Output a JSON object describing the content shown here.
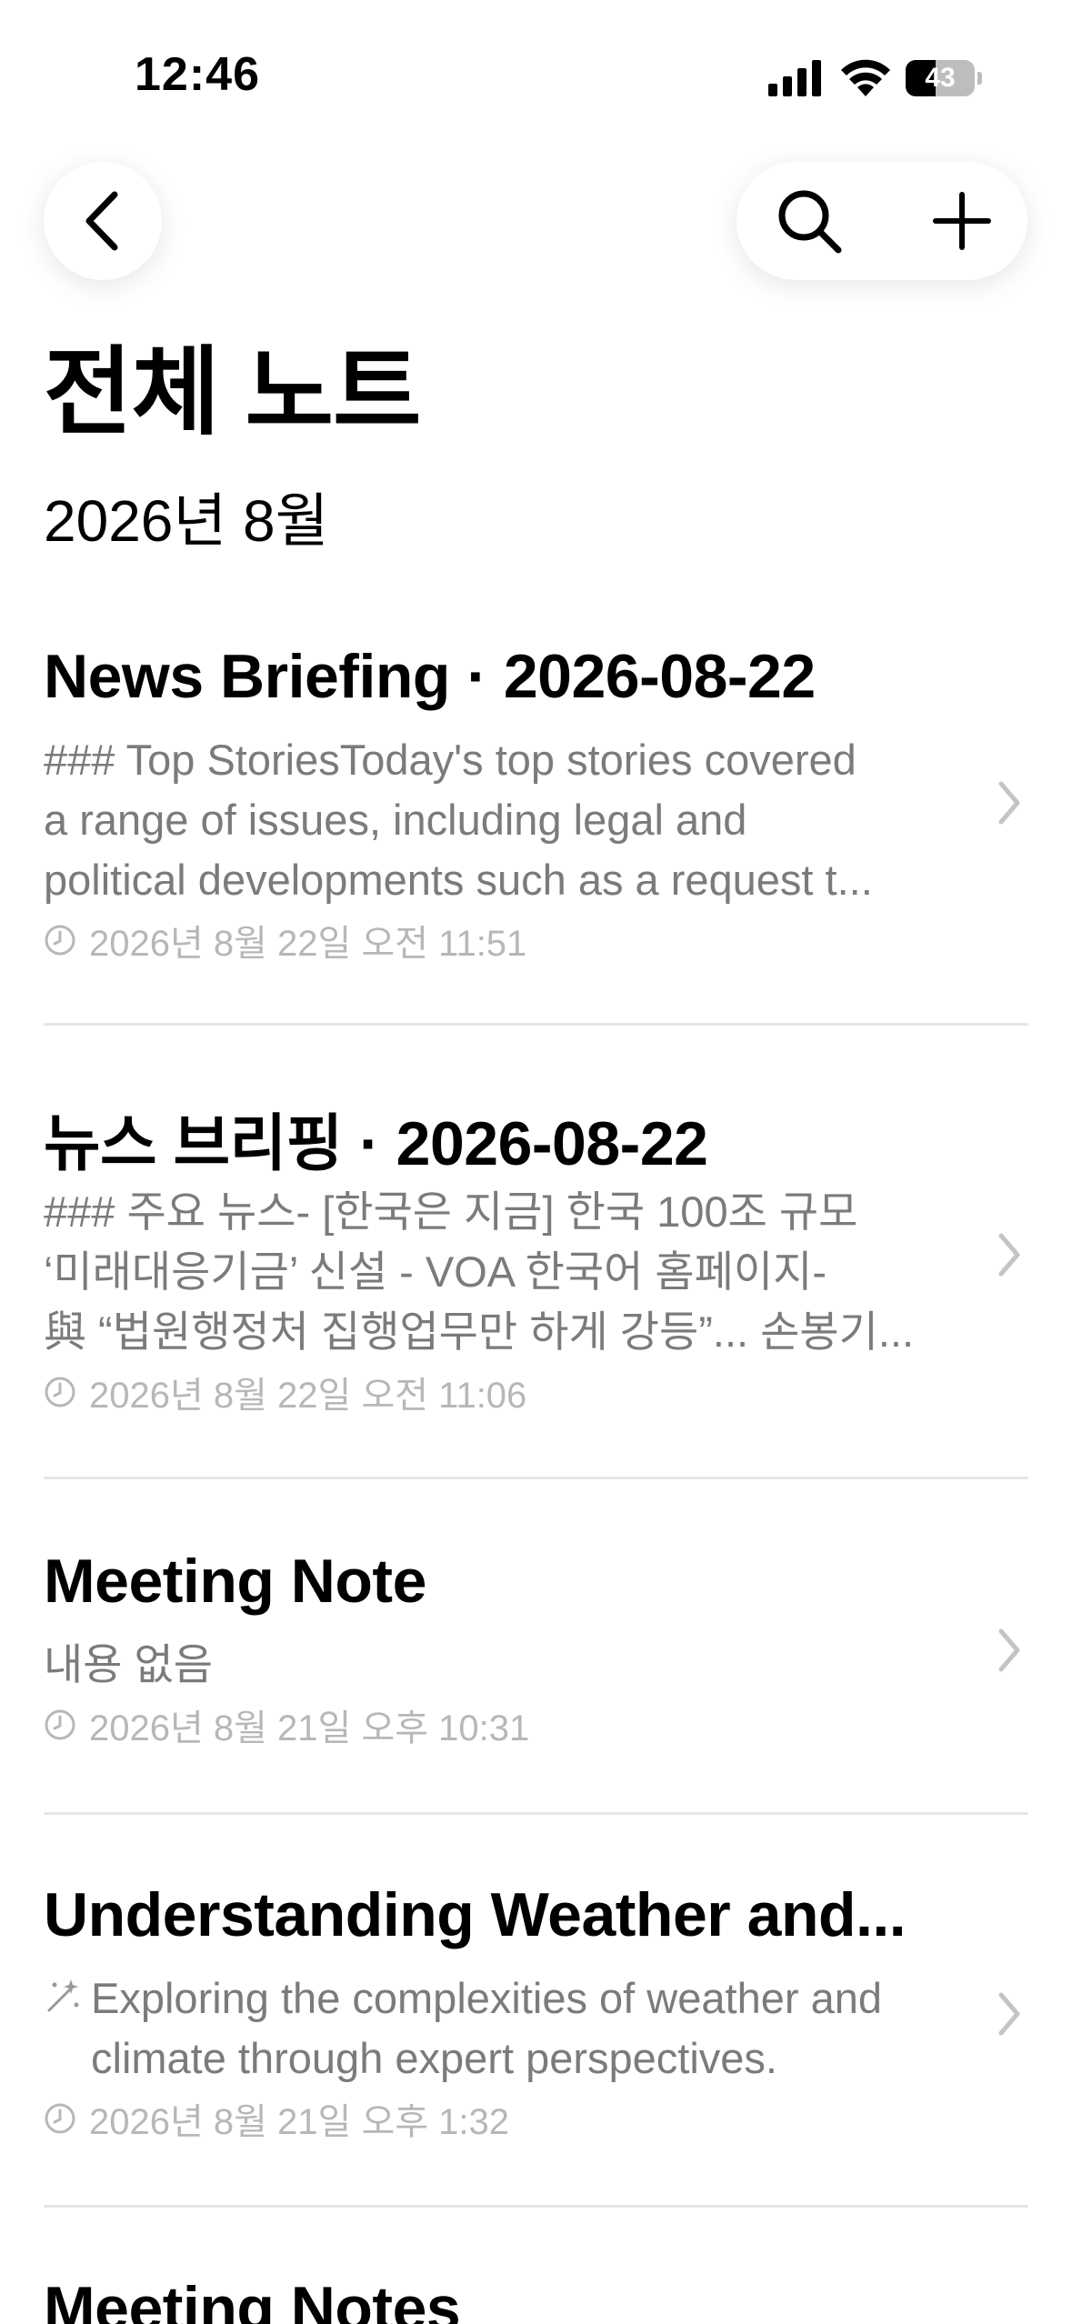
{
  "status_bar": {
    "time": "12:46",
    "battery_level": "43",
    "battery_fraction": 0.43
  },
  "nav": {
    "back_icon": "chevron-left-icon",
    "search_icon": "search-icon",
    "add_icon": "plus-icon"
  },
  "page": {
    "title": "전체 노트",
    "section": "2026년 8월"
  },
  "notes": [
    {
      "title": "News Briefing · 2026-08-22",
      "preview": [
        "### Top StoriesToday's top stories covered",
        "a range of issues, including legal and",
        "political developments such as a request t..."
      ],
      "date": "2026년 8월 22일 오전 11:51"
    },
    {
      "title": "뉴스 브리핑 · 2026-08-22",
      "preview": [
        "### 주요 뉴스- [한국은 지금] 한국 100조 규모",
        "‘미래대응기금’ 신설 - VOA 한국어 홈페이지-",
        "與 “법원행정처 집행업무만 하게 강등”... 손봉기..."
      ],
      "date": "2026년 8월 22일 오전 11:06"
    },
    {
      "title": "Meeting Note",
      "preview": [
        "내용 없음"
      ],
      "date": "2026년 8월 21일 오후 10:31"
    },
    {
      "title": "Understanding Weather and...",
      "preview": [
        "Exploring the complexities of weather and",
        "climate through expert perspectives."
      ],
      "date": "2026년 8월 21일 오후 1:32",
      "ai_icon": "magic-wand-icon"
    },
    {
      "title": "Meeting Notes"
    }
  ],
  "colors": {
    "title": "#000000",
    "preview": "#7b7b7b",
    "date": "#b7b7b7",
    "divider": "#e6e6e6"
  }
}
